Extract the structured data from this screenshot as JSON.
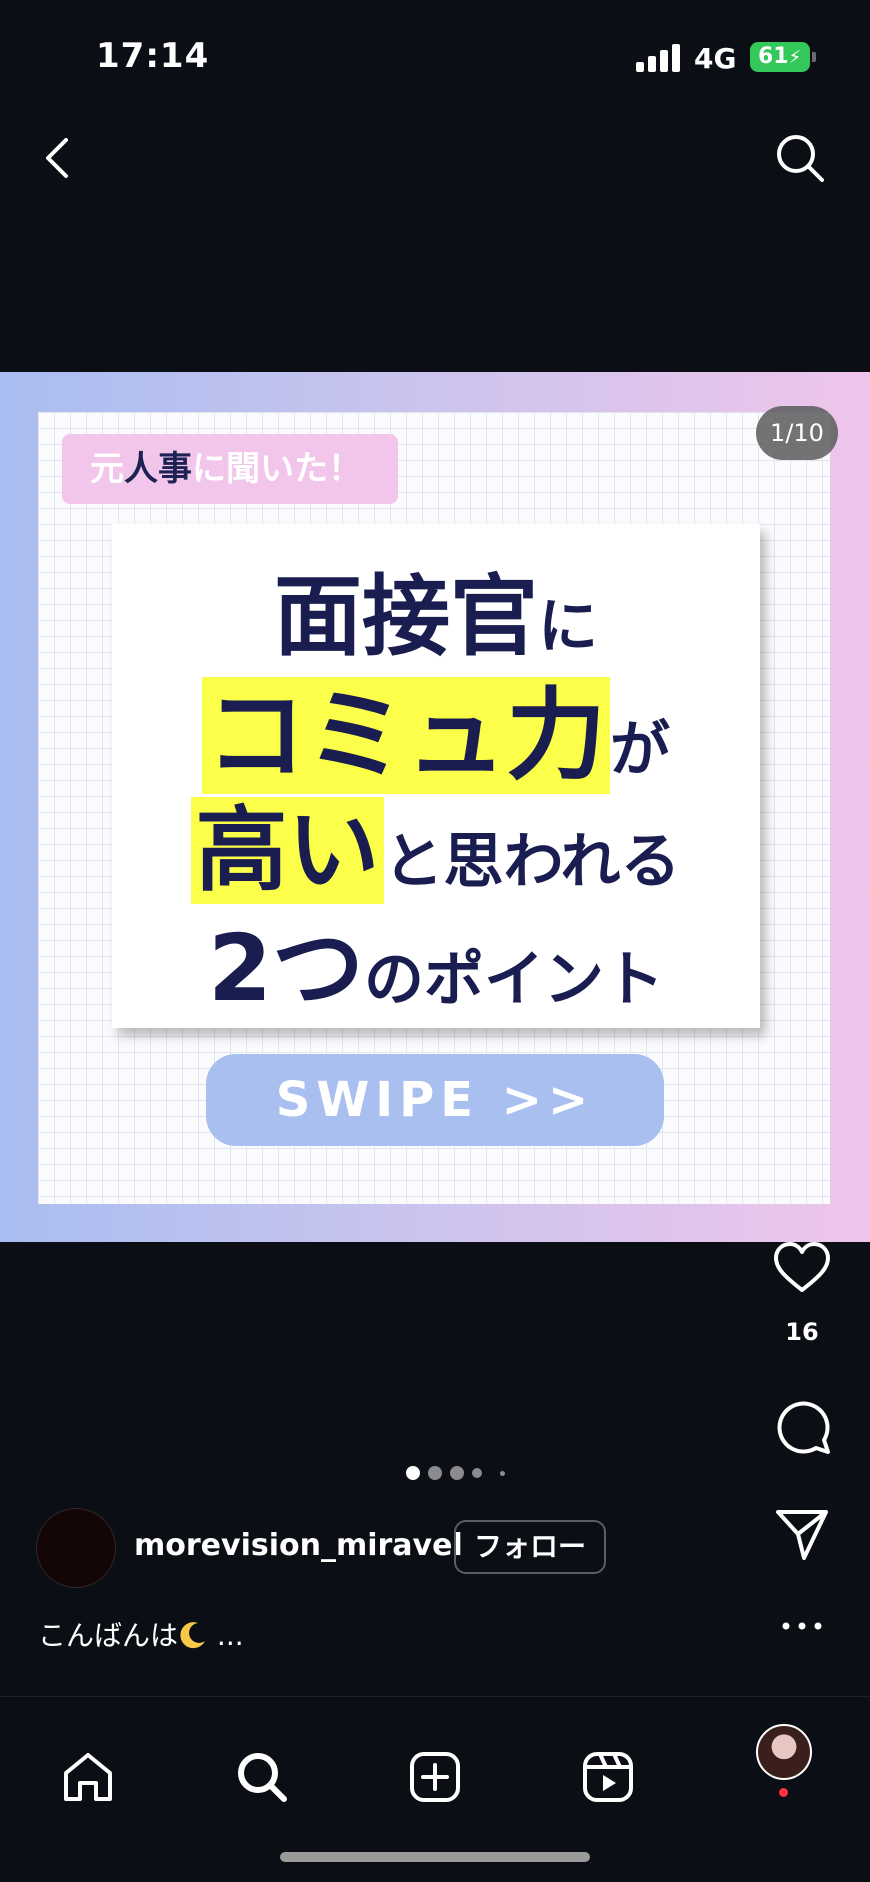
{
  "status_bar": {
    "time": "17:14",
    "network": "4G",
    "battery": "61"
  },
  "post": {
    "counter": "1/10",
    "tag": {
      "prefix": "元",
      "bold": "人事",
      "suffix": "に聞いた！"
    },
    "headline": {
      "line1_a": "面接官",
      "line1_b": "に",
      "line2_a": "コミュ力",
      "line2_b": "が",
      "line3_a": "高い",
      "line3_b": "と思われる",
      "line4_a": "2つ",
      "line4_b": "のポイント"
    },
    "swipe_label": "SWIPE >>"
  },
  "actions": {
    "likes": "16"
  },
  "carousel": {
    "count": 5,
    "active_index": 0
  },
  "user": {
    "username": "morevision_miravel",
    "follow_label": "フォロー"
  },
  "caption": {
    "text": "こんばんは",
    "more": " ..."
  },
  "colors": {
    "background": "#0b0e14",
    "highlight": "#fbff4a",
    "headline": "#1a1d4f",
    "swipe": "#a8bff0",
    "tag": "#f2c6ea"
  },
  "icons": [
    "back-chevron-icon",
    "search-icon",
    "heart-icon",
    "comment-icon",
    "send-icon",
    "more-icon",
    "home-icon",
    "plus-square-icon",
    "reels-icon"
  ]
}
